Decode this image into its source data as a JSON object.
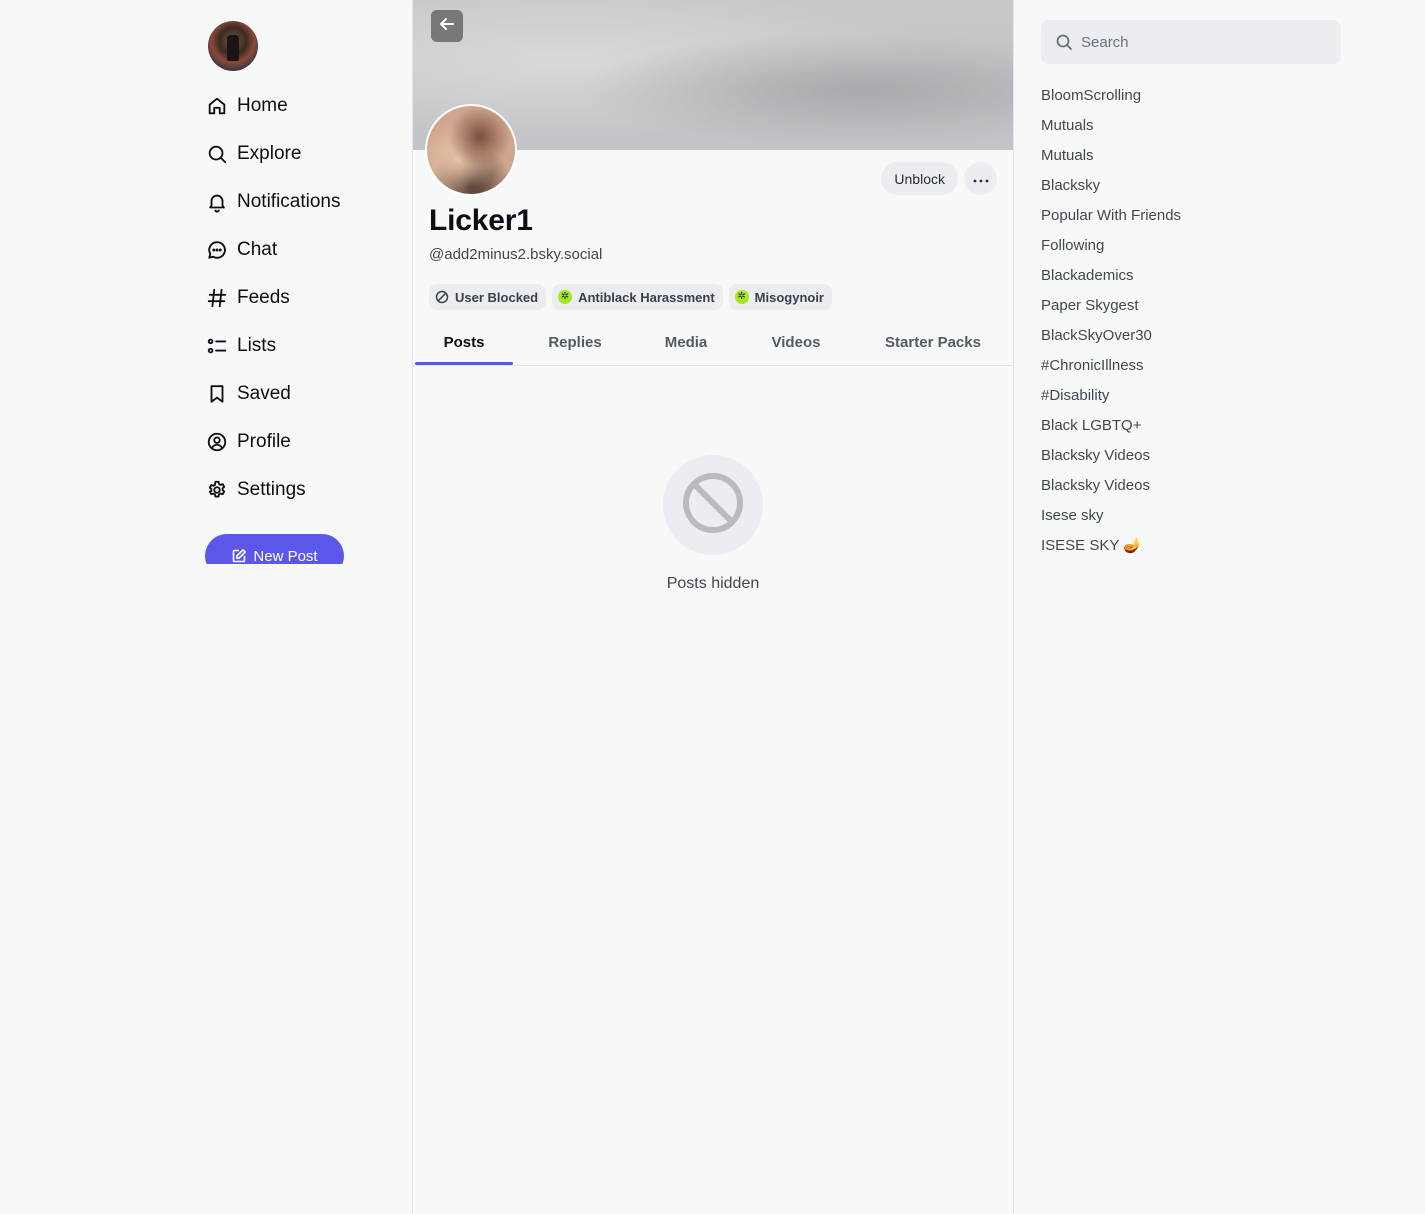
{
  "nav": {
    "items": [
      {
        "label": "Home",
        "icon": "home-icon"
      },
      {
        "label": "Explore",
        "icon": "search-icon"
      },
      {
        "label": "Notifications",
        "icon": "bell-icon"
      },
      {
        "label": "Chat",
        "icon": "chat-icon"
      },
      {
        "label": "Feeds",
        "icon": "hash-icon"
      },
      {
        "label": "Lists",
        "icon": "list-icon"
      },
      {
        "label": "Saved",
        "icon": "bookmark-icon"
      },
      {
        "label": "Profile",
        "icon": "profile-icon"
      },
      {
        "label": "Settings",
        "icon": "gear-icon"
      }
    ],
    "new_post_label": "New Post"
  },
  "profile": {
    "display_name": "Licker1",
    "handle": "@add2minus2.bsky.social",
    "unblock_label": "Unblock",
    "labels": [
      {
        "text": "User Blocked",
        "icon": "block-icon"
      },
      {
        "text": "Antiblack Harassment",
        "icon": "labeler-badge-icon"
      },
      {
        "text": "Misogynoir",
        "icon": "labeler-badge-icon"
      }
    ],
    "tabs": [
      "Posts",
      "Replies",
      "Media",
      "Videos",
      "Starter Packs"
    ],
    "active_tab": "Posts",
    "empty_state": "Posts hidden"
  },
  "right": {
    "search_placeholder": "Search",
    "feeds": [
      "BloomScrolling",
      "Mutuals",
      "Mutuals",
      "Blacksky",
      "Popular With Friends",
      "Following",
      "Blackademics",
      "Paper Skygest",
      "BlackSkyOver30",
      "#ChronicIllness",
      "#Disability",
      "Black LGBTQ+",
      "Blacksky Videos",
      "Blacksky Videos",
      "Isese sky",
      "ISESE SKY 🪔"
    ]
  },
  "colors": {
    "accent": "#5b57e8",
    "background": "#f7f9f8",
    "labeler_badge": "#a6e62a"
  }
}
